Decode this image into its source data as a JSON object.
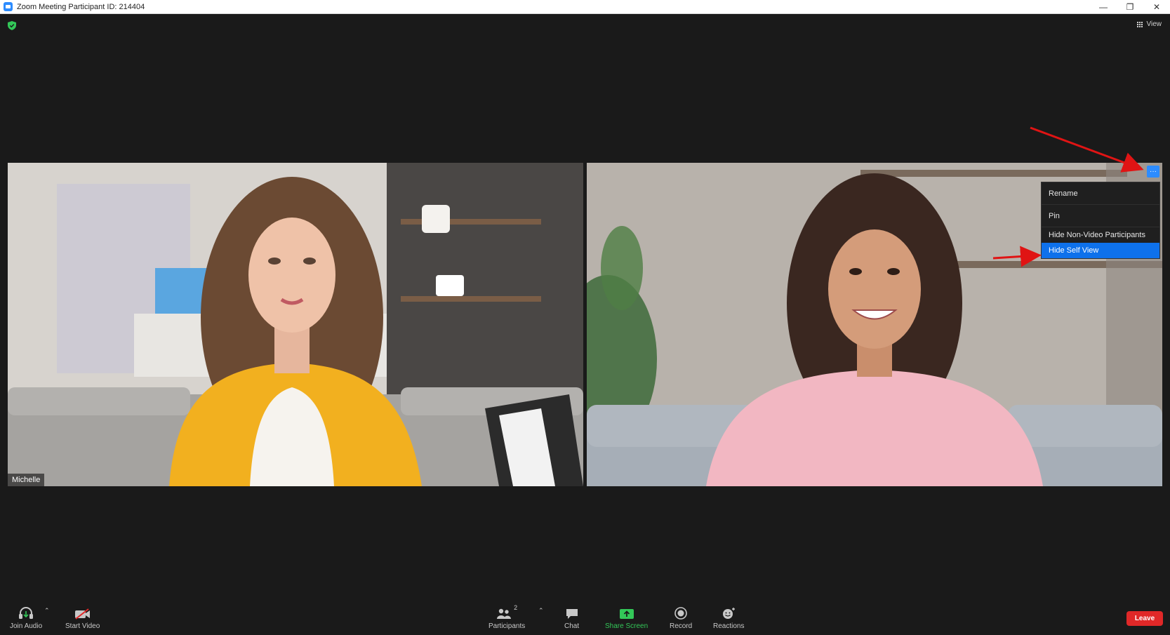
{
  "window": {
    "title": "Zoom Meeting Participant ID: 214404",
    "controls": [
      "minimize-icon",
      "restore-icon",
      "close-icon"
    ]
  },
  "top": {
    "security_icon": "shield-icon",
    "view_label": "View"
  },
  "tiles": {
    "left_name": "Michelle",
    "right_more_label": "···"
  },
  "menu": {
    "items": [
      "Rename",
      "Pin",
      "Hide Non-Video Participants",
      "Hide Self View"
    ],
    "selected": "Hide Self View"
  },
  "toolbar": {
    "join_audio": "Join Audio",
    "start_video": "Start Video",
    "participants": "Participants",
    "participants_count": "2",
    "chat": "Chat",
    "share_screen": "Share Screen",
    "record": "Record",
    "reactions": "Reactions",
    "leave": "Leave"
  },
  "colors": {
    "accent_blue": "#0e71eb",
    "share_green": "#33c758",
    "leave_red": "#e02828",
    "annotation_red": "#e01414"
  }
}
